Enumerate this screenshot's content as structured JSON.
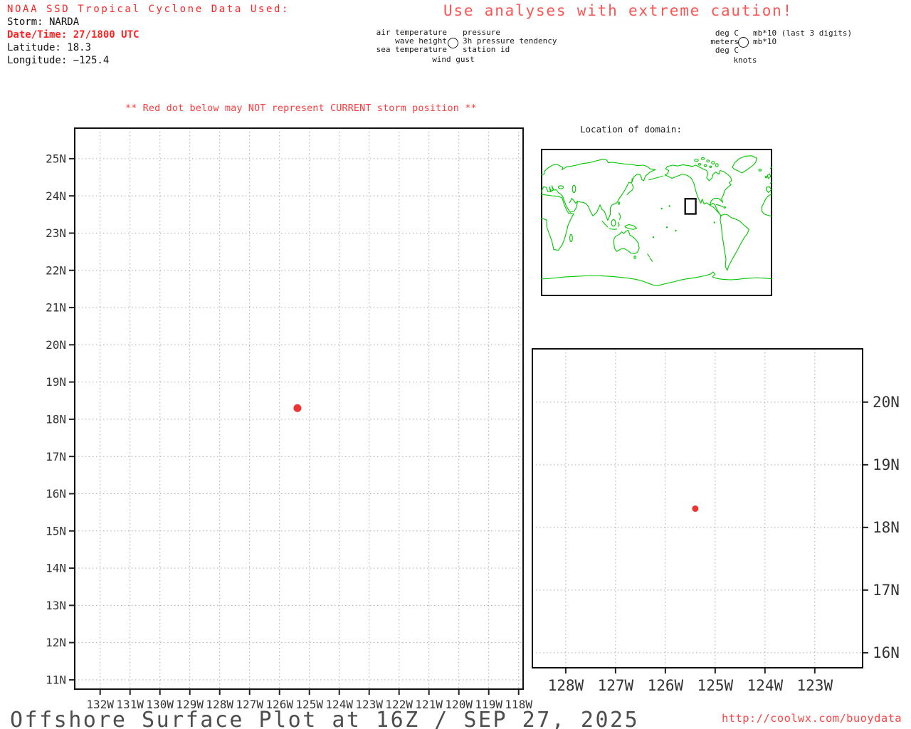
{
  "header": {
    "line1": "NOAA SSD Tropical Cyclone Data Used:",
    "storm": "Storm: NARDA",
    "datetime": "Date/Time: 27/1800 UTC",
    "latitude": "Latitude: 18.3",
    "longitude": "Longitude: −125.4"
  },
  "caution": "Use analyses with extreme caution!",
  "station_legend": {
    "left": [
      "air temperature",
      "wave height",
      "sea temperature"
    ],
    "right": [
      "pressure",
      "3h pressure tendency",
      "station id"
    ],
    "bottom": "wind gust",
    "circle_icon": "station-circle"
  },
  "units_legend": {
    "left": [
      "deg C",
      "meters",
      "deg C"
    ],
    "right": [
      "mb*10 (last 3 digits)",
      "mb*10"
    ],
    "bottom": "knots",
    "circle_icon": "station-circle"
  },
  "warning": "** Red dot below may NOT represent CURRENT storm position **",
  "domain_map": {
    "title": "Location of domain:"
  },
  "footer": {
    "title": "Offshore Surface Plot at 16Z / SEP 27, 2025",
    "url": "http://coolwx.com/buoydata"
  },
  "colors": {
    "header_red": "#ff2424",
    "caution_red": "#ff5454",
    "warning_red": "#ff3c3c",
    "url_red": "#ff4444",
    "storm_dot_red": "#ee3333",
    "map_green": "#00c800",
    "grid_gray": "#aaaaaa",
    "axis_label_gray": "#333333",
    "border_black": "#111111",
    "footer_gray": "#4d4d4d"
  },
  "chart_data": [
    {
      "type": "scatter",
      "name": "main-storm-plot",
      "grid": true,
      "xlim": [
        -132.85,
        -117.85
      ],
      "ylim": [
        10.75,
        25.82
      ],
      "x_tick_lons": [
        -132,
        -131,
        -130,
        -129,
        -128,
        -127,
        -126,
        -125,
        -124,
        -123,
        -122,
        -121,
        -120,
        -119,
        -118
      ],
      "x_tick_labels": [
        "132W",
        "131W",
        "130W",
        "129W",
        "128W",
        "127W",
        "126W",
        "125W",
        "124W",
        "123W",
        "122W",
        "121W",
        "120W",
        "119W",
        "118W"
      ],
      "y_tick_lats": [
        25,
        24,
        23,
        22,
        21,
        20,
        19,
        18,
        17,
        16,
        15,
        14,
        13,
        12,
        11
      ],
      "y_tick_labels": [
        "25N",
        "24N",
        "23N",
        "22N",
        "21N",
        "20N",
        "19N",
        "18N",
        "17N",
        "16N",
        "15N",
        "14N",
        "13N",
        "12N",
        "11N"
      ],
      "points": [
        {
          "lon": -125.4,
          "lat": 18.3
        }
      ]
    },
    {
      "type": "scatter",
      "name": "inset-storm-plot",
      "grid": true,
      "xlim": [
        -128.67,
        -122.04
      ],
      "ylim": [
        15.76,
        20.85
      ],
      "x_tick_lons": [
        -128,
        -127,
        -126,
        -125,
        -124,
        -123
      ],
      "x_tick_labels": [
        "128W",
        "127W",
        "126W",
        "125W",
        "124W",
        "123W"
      ],
      "y_tick_lats": [
        20,
        19,
        18,
        17,
        16
      ],
      "y_tick_labels": [
        "20N",
        "19N",
        "18N",
        "17N",
        "16N"
      ],
      "points": [
        {
          "lon": -125.4,
          "lat": 18.3
        }
      ]
    }
  ]
}
